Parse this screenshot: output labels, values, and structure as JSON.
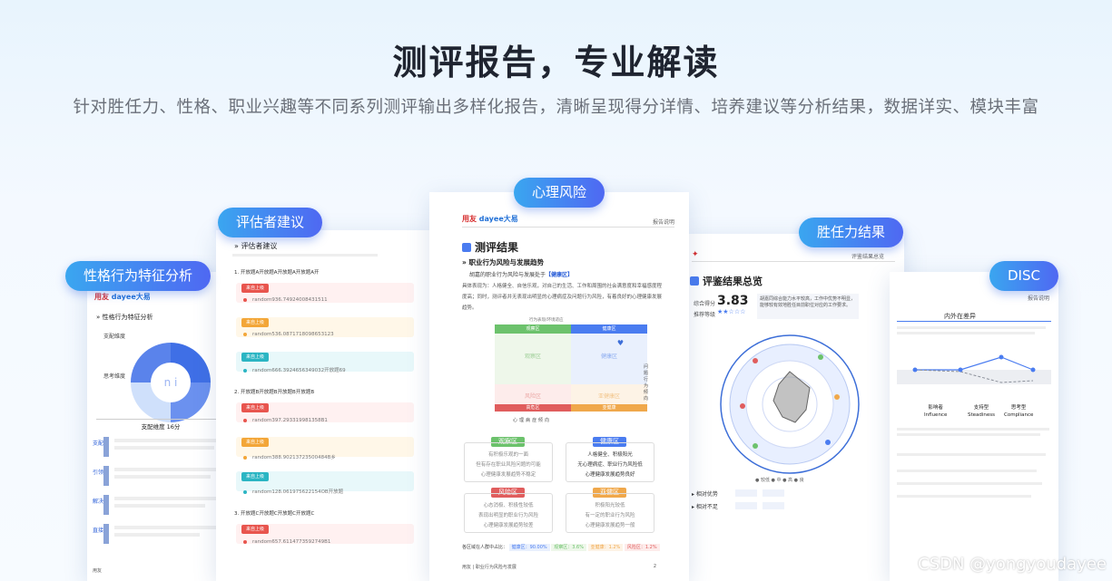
{
  "header": {
    "title": "测评报告，专业解读",
    "subtitle": "针对胜任力、性格、职业兴趣等不同系列测评输出多样化报告，清晰呈现得分详情、培养建议等分析结果，数据详实、模块丰富"
  },
  "labels": {
    "behavior": "性格行为特征分析",
    "evaluator": "评估者建议",
    "psych": "心理风险",
    "competency": "胜任力结果",
    "disc": "DISC"
  },
  "card1": {
    "logo_a": "用友",
    "logo_b": "dayee大易",
    "heading": "性格行为特征分析",
    "dom_label": "支配维度",
    "think_label": "思考维度",
    "score_label": "支配维度 16分",
    "rows": [
      "支配",
      "引领",
      "解决",
      "直接"
    ],
    "footer": "用友"
  },
  "card2": {
    "heading": "评估者建议",
    "q1": "1. 开放题A开放题A开放题A开放题A开",
    "q2": "2. 开放题B开放题B开放题B开放题B",
    "q3": "3. 开放题C开放题C开放题C开放题C",
    "items": [
      "random936.74924008431511",
      "random536.0871718098653123",
      "random666.3924656349032开放题69",
      "random397.293319981358B1",
      "random388.90213723500484B乡",
      "random128.061975622154OB开放题",
      "random657.6114773592749B1"
    ],
    "tag": "来自上级"
  },
  "card3": {
    "logo_a": "用友",
    "logo_b": "dayee大易",
    "corner": "报告说明",
    "heading": "测评结果",
    "sub": "职业行为风险与发展趋势",
    "line1": "胡嘉的职业行为风险与发展处于",
    "zone": "【健康区】",
    "para": "具体表现为：人格健全、自信乐观，对自己的生活、工作和周围的社会满意度和幸福感度程度高；同时，测评者并无表现出明显的心理病症及问题行为风险，有着良好的心理健康发展趋势。",
    "chart_top": "行为表现/环境适应",
    "y_label": "问题行为倾向",
    "x_label": "心理病症倾向",
    "q_tl": "观察区",
    "q_tr": "健康区",
    "q_bl": "风险区",
    "q_br": "亚健康区",
    "bar_l": "高危区",
    "bar_r": "亚健康",
    "boxes": [
      {
        "h": "观察区",
        "lines": [
          "有积极乐观的一面",
          "但有存在职业风险问题的可能",
          "心理健康发展趋势不稳定"
        ]
      },
      {
        "h": "健康区",
        "lines": [
          "人格健全、积极阳光",
          "无心理病症、职业行为风险低",
          "心理健康发展趋势良好"
        ]
      },
      {
        "h": "风险区",
        "lines": [
          "心态消极、积极性较低",
          "表现出明显的职业行为风险",
          "心理健康发展趋势较差"
        ]
      },
      {
        "h": "亚健区",
        "lines": [
          "积极阳光较低",
          "有一定的职业行为风险",
          "心理健康发展趋势一般"
        ]
      }
    ],
    "stats_label": "各区域在人群中占比：",
    "stats": [
      "健康区：90.00%",
      "观察区：3.6%",
      "亚健康：1.2%",
      "风险区：1.2%"
    ],
    "footer_a": "用友",
    "footer_b": "职业行为风险与发展",
    "page": "2"
  },
  "card4": {
    "corner": "评鉴结果总览",
    "heading": "评鉴结果总览",
    "score_label": "综合得分",
    "score": "3.83",
    "level_label": "推荐等级",
    "rating": "★★☆☆☆",
    "side_text": "胡嘉同综合能力水平较高，工作中优势不明显，能够较有效地胜任目前职位对应的工作要求。",
    "r1": "相对优势",
    "r2": "相对不足"
  },
  "card5": {
    "corner": "报告说明",
    "heading": "内外在差异",
    "axis": [
      "影响者",
      "支持型",
      "思考型"
    ],
    "axis_en": [
      "Influence",
      "Steadiness",
      "Compliance"
    ]
  },
  "watermark": "CSDN @yongyoudayee",
  "colors": {
    "accent": "#4a7cf0",
    "healthy": "#4a90e2",
    "observe": "#6cc26c",
    "risk": "#e05d5d",
    "subhealth": "#f0a84b"
  }
}
